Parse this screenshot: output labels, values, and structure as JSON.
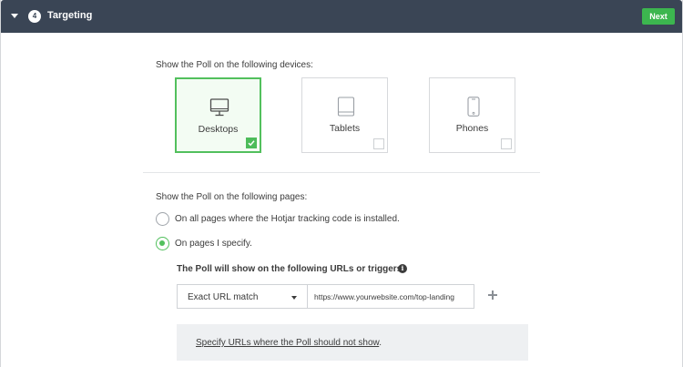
{
  "header": {
    "step_number": "4",
    "title": "Targeting",
    "next_label": "Next"
  },
  "devices": {
    "heading": "Show the Poll on the following devices:",
    "items": [
      {
        "label": "Desktops",
        "checked": true,
        "icon": "desktop-icon"
      },
      {
        "label": "Tablets",
        "checked": false,
        "icon": "tablet-icon"
      },
      {
        "label": "Phones",
        "checked": false,
        "icon": "phone-icon"
      }
    ]
  },
  "pages": {
    "heading": "Show the Poll on the following pages:",
    "options": [
      {
        "label": "On all pages where the Hotjar tracking code is installed.",
        "selected": false
      },
      {
        "label": "On pages I specify.",
        "selected": true
      }
    ],
    "urls_heading": "The Poll will show on the following URLs or triggers:",
    "match_type": "Exact URL match",
    "url_value": "https://www.yourwebsite.com/top-landing",
    "exclude_link": "Specify URLs where the Poll should not show",
    "exclude_suffix": "."
  },
  "colors": {
    "header_bg": "#3a4555",
    "accent_green": "#52c05d",
    "next_button": "#3cb64f"
  }
}
